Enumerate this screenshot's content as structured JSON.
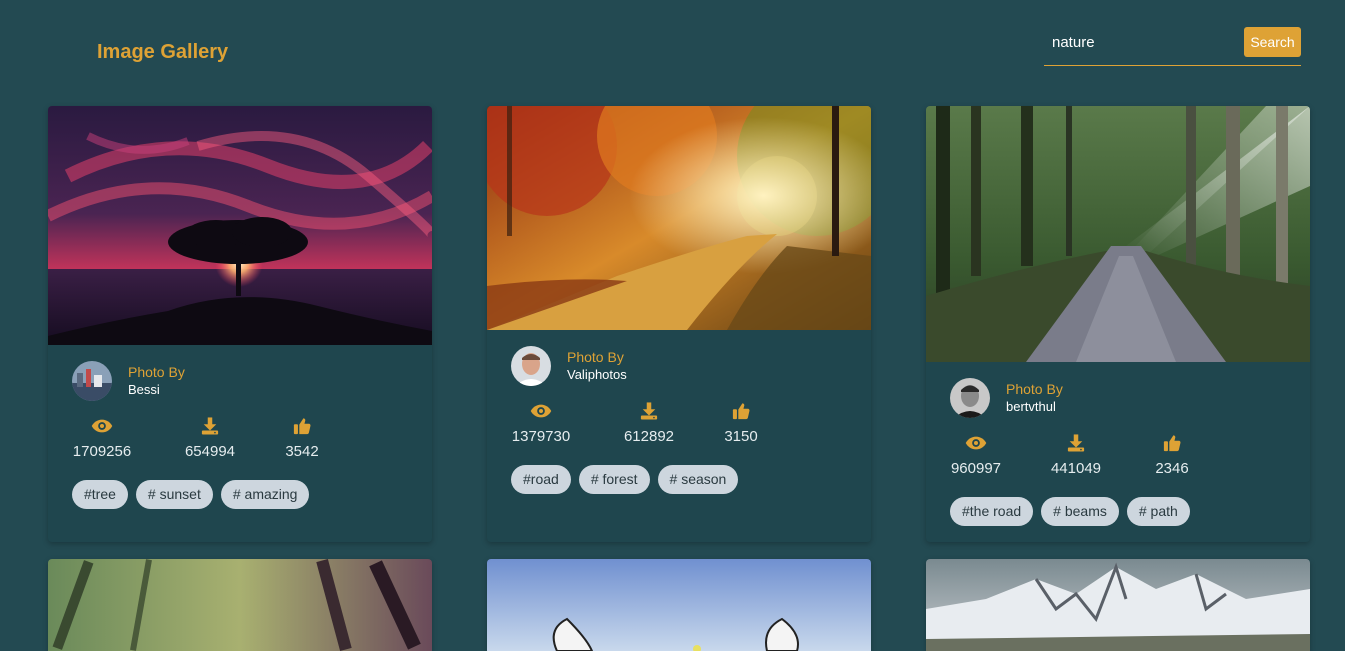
{
  "header": {
    "title": "Image Gallery",
    "search_value": "nature",
    "search_button": "Search"
  },
  "icons": {
    "views": "eye-icon",
    "downloads": "download-icon",
    "likes": "thumbs-up-icon"
  },
  "colors": {
    "background": "#234a52",
    "accent": "#dea235",
    "card": "#1f464e",
    "tag": "#cdd6de"
  },
  "cards": [
    {
      "photo_by": "Photo By",
      "author": "Bessi",
      "views": "1709256",
      "downloads": "654994",
      "likes": "3542",
      "tags": [
        "#tree",
        "# sunset",
        "# amazing"
      ]
    },
    {
      "photo_by": "Photo By",
      "author": "Valiphotos",
      "views": "1379730",
      "downloads": "612892",
      "likes": "3150",
      "tags": [
        "#road",
        "# forest",
        "# season"
      ]
    },
    {
      "photo_by": "Photo By",
      "author": "bertvthul",
      "views": "960997",
      "downloads": "441049",
      "likes": "2346",
      "tags": [
        "#the road",
        "# beams",
        "# path"
      ]
    }
  ]
}
